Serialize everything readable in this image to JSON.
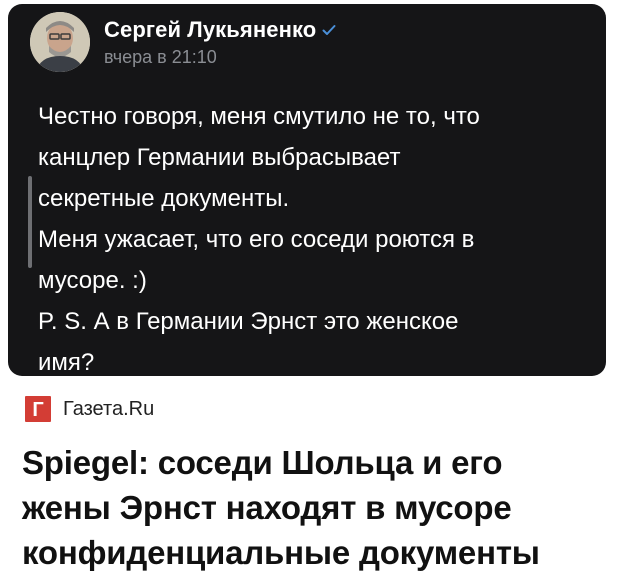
{
  "post": {
    "author": "Сергей Лукьяненко",
    "timestamp": "вчера в 21:10",
    "verified_icon": "verified-check-icon",
    "lines": [
      "Честно говоря, меня смутило не то, что",
      "канцлер Германии выбрасывает",
      "секретные документы.",
      "Меня ужасает, что его соседи роются в",
      "мусоре. :)",
      "P. S. А в Германии Эрнст это женское",
      "имя?"
    ]
  },
  "link_preview": {
    "source_logo": "Г",
    "source_name": "Газета.Ru",
    "headline_lines": [
      "Spiegel: соседи Шольца и его",
      "жены Эрнст находят в мусоре",
      "конфиденциальные документы"
    ]
  },
  "colors": {
    "card_bg": "#151517",
    "text": "#ffffff",
    "muted": "#8a8d93",
    "verified": "#4a8fd8",
    "logo_red": "#d33d35"
  }
}
